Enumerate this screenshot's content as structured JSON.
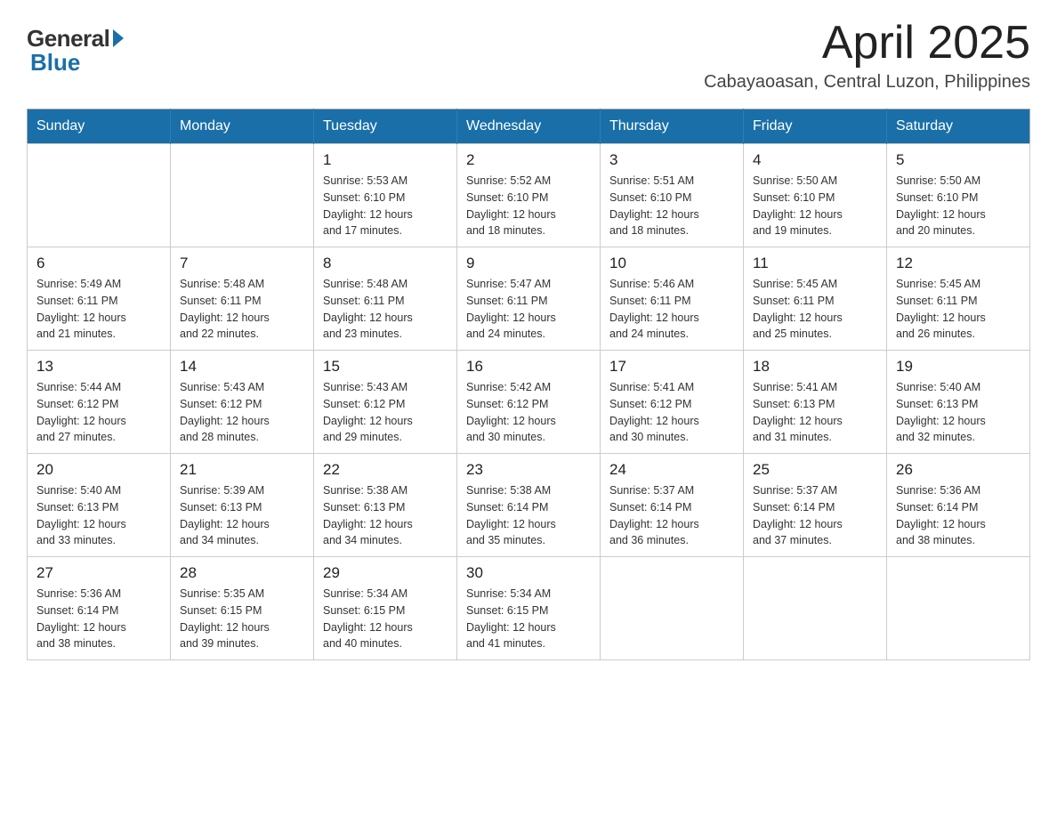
{
  "logo": {
    "general": "General",
    "blue": "Blue"
  },
  "title": "April 2025",
  "location": "Cabayaoasan, Central Luzon, Philippines",
  "days_of_week": [
    "Sunday",
    "Monday",
    "Tuesday",
    "Wednesday",
    "Thursday",
    "Friday",
    "Saturday"
  ],
  "weeks": [
    [
      {
        "day": "",
        "info": ""
      },
      {
        "day": "",
        "info": ""
      },
      {
        "day": "1",
        "info": "Sunrise: 5:53 AM\nSunset: 6:10 PM\nDaylight: 12 hours\nand 17 minutes."
      },
      {
        "day": "2",
        "info": "Sunrise: 5:52 AM\nSunset: 6:10 PM\nDaylight: 12 hours\nand 18 minutes."
      },
      {
        "day": "3",
        "info": "Sunrise: 5:51 AM\nSunset: 6:10 PM\nDaylight: 12 hours\nand 18 minutes."
      },
      {
        "day": "4",
        "info": "Sunrise: 5:50 AM\nSunset: 6:10 PM\nDaylight: 12 hours\nand 19 minutes."
      },
      {
        "day": "5",
        "info": "Sunrise: 5:50 AM\nSunset: 6:10 PM\nDaylight: 12 hours\nand 20 minutes."
      }
    ],
    [
      {
        "day": "6",
        "info": "Sunrise: 5:49 AM\nSunset: 6:11 PM\nDaylight: 12 hours\nand 21 minutes."
      },
      {
        "day": "7",
        "info": "Sunrise: 5:48 AM\nSunset: 6:11 PM\nDaylight: 12 hours\nand 22 minutes."
      },
      {
        "day": "8",
        "info": "Sunrise: 5:48 AM\nSunset: 6:11 PM\nDaylight: 12 hours\nand 23 minutes."
      },
      {
        "day": "9",
        "info": "Sunrise: 5:47 AM\nSunset: 6:11 PM\nDaylight: 12 hours\nand 24 minutes."
      },
      {
        "day": "10",
        "info": "Sunrise: 5:46 AM\nSunset: 6:11 PM\nDaylight: 12 hours\nand 24 minutes."
      },
      {
        "day": "11",
        "info": "Sunrise: 5:45 AM\nSunset: 6:11 PM\nDaylight: 12 hours\nand 25 minutes."
      },
      {
        "day": "12",
        "info": "Sunrise: 5:45 AM\nSunset: 6:11 PM\nDaylight: 12 hours\nand 26 minutes."
      }
    ],
    [
      {
        "day": "13",
        "info": "Sunrise: 5:44 AM\nSunset: 6:12 PM\nDaylight: 12 hours\nand 27 minutes."
      },
      {
        "day": "14",
        "info": "Sunrise: 5:43 AM\nSunset: 6:12 PM\nDaylight: 12 hours\nand 28 minutes."
      },
      {
        "day": "15",
        "info": "Sunrise: 5:43 AM\nSunset: 6:12 PM\nDaylight: 12 hours\nand 29 minutes."
      },
      {
        "day": "16",
        "info": "Sunrise: 5:42 AM\nSunset: 6:12 PM\nDaylight: 12 hours\nand 30 minutes."
      },
      {
        "day": "17",
        "info": "Sunrise: 5:41 AM\nSunset: 6:12 PM\nDaylight: 12 hours\nand 30 minutes."
      },
      {
        "day": "18",
        "info": "Sunrise: 5:41 AM\nSunset: 6:13 PM\nDaylight: 12 hours\nand 31 minutes."
      },
      {
        "day": "19",
        "info": "Sunrise: 5:40 AM\nSunset: 6:13 PM\nDaylight: 12 hours\nand 32 minutes."
      }
    ],
    [
      {
        "day": "20",
        "info": "Sunrise: 5:40 AM\nSunset: 6:13 PM\nDaylight: 12 hours\nand 33 minutes."
      },
      {
        "day": "21",
        "info": "Sunrise: 5:39 AM\nSunset: 6:13 PM\nDaylight: 12 hours\nand 34 minutes."
      },
      {
        "day": "22",
        "info": "Sunrise: 5:38 AM\nSunset: 6:13 PM\nDaylight: 12 hours\nand 34 minutes."
      },
      {
        "day": "23",
        "info": "Sunrise: 5:38 AM\nSunset: 6:14 PM\nDaylight: 12 hours\nand 35 minutes."
      },
      {
        "day": "24",
        "info": "Sunrise: 5:37 AM\nSunset: 6:14 PM\nDaylight: 12 hours\nand 36 minutes."
      },
      {
        "day": "25",
        "info": "Sunrise: 5:37 AM\nSunset: 6:14 PM\nDaylight: 12 hours\nand 37 minutes."
      },
      {
        "day": "26",
        "info": "Sunrise: 5:36 AM\nSunset: 6:14 PM\nDaylight: 12 hours\nand 38 minutes."
      }
    ],
    [
      {
        "day": "27",
        "info": "Sunrise: 5:36 AM\nSunset: 6:14 PM\nDaylight: 12 hours\nand 38 minutes."
      },
      {
        "day": "28",
        "info": "Sunrise: 5:35 AM\nSunset: 6:15 PM\nDaylight: 12 hours\nand 39 minutes."
      },
      {
        "day": "29",
        "info": "Sunrise: 5:34 AM\nSunset: 6:15 PM\nDaylight: 12 hours\nand 40 minutes."
      },
      {
        "day": "30",
        "info": "Sunrise: 5:34 AM\nSunset: 6:15 PM\nDaylight: 12 hours\nand 41 minutes."
      },
      {
        "day": "",
        "info": ""
      },
      {
        "day": "",
        "info": ""
      },
      {
        "day": "",
        "info": ""
      }
    ]
  ]
}
